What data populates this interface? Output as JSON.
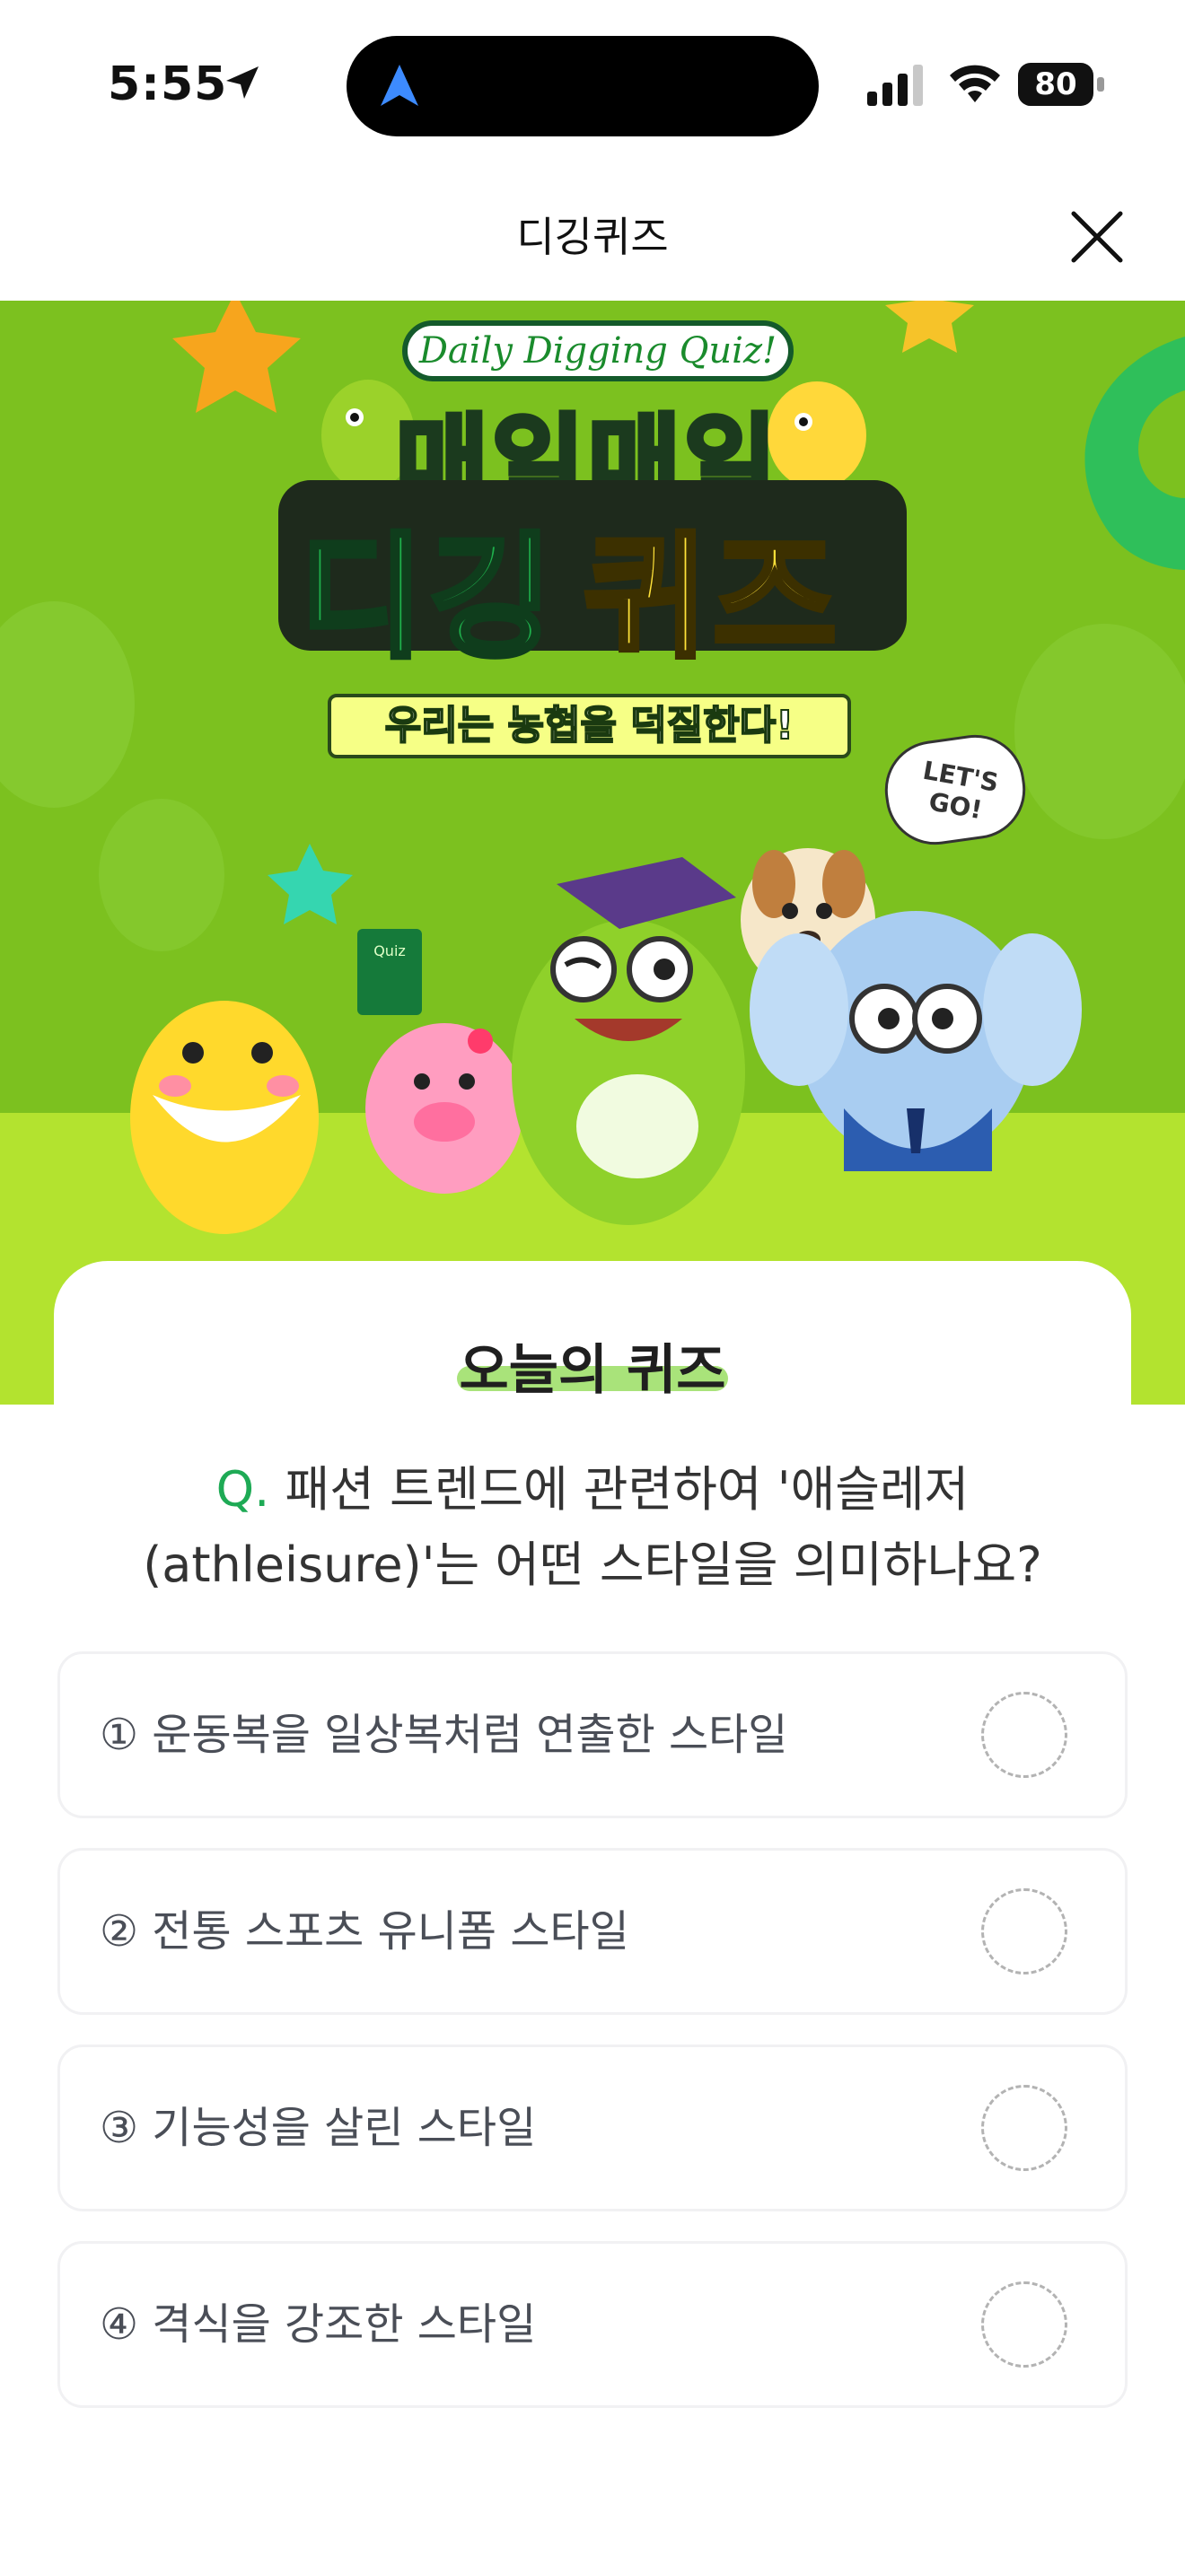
{
  "status_bar": {
    "time": "5:55",
    "battery": "80"
  },
  "header": {
    "title": "디깅퀴즈"
  },
  "banner": {
    "tagline": "Daily Digging Quiz!",
    "headline_top": "매일매일",
    "headline_green": "디깅",
    "headline_yellow": "퀴즈",
    "subheadline": "우리는 농협을 덕질한다!",
    "bubble_text": "LET'S GO!",
    "book_text": "Quiz"
  },
  "quiz": {
    "section_title": "오늘의 퀴즈",
    "question_prefix": "Q.",
    "question": "패션 트렌드에 관련하여 '애슬레저 (athleisure)'는 어떤 스타일을 의미하나요?",
    "options": [
      {
        "label": "① 운동복을 일상복처럼 연출한 스타일"
      },
      {
        "label": "② 전통 스포츠 유니폼 스타일"
      },
      {
        "label": "③ 기능성을 살린 스타일"
      },
      {
        "label": "④ 격식을 강조한 스타일"
      }
    ]
  },
  "colors": {
    "banner_green": "#7cc11f",
    "accent_green": "#1eaa55",
    "highlight": "#a9e37a"
  }
}
